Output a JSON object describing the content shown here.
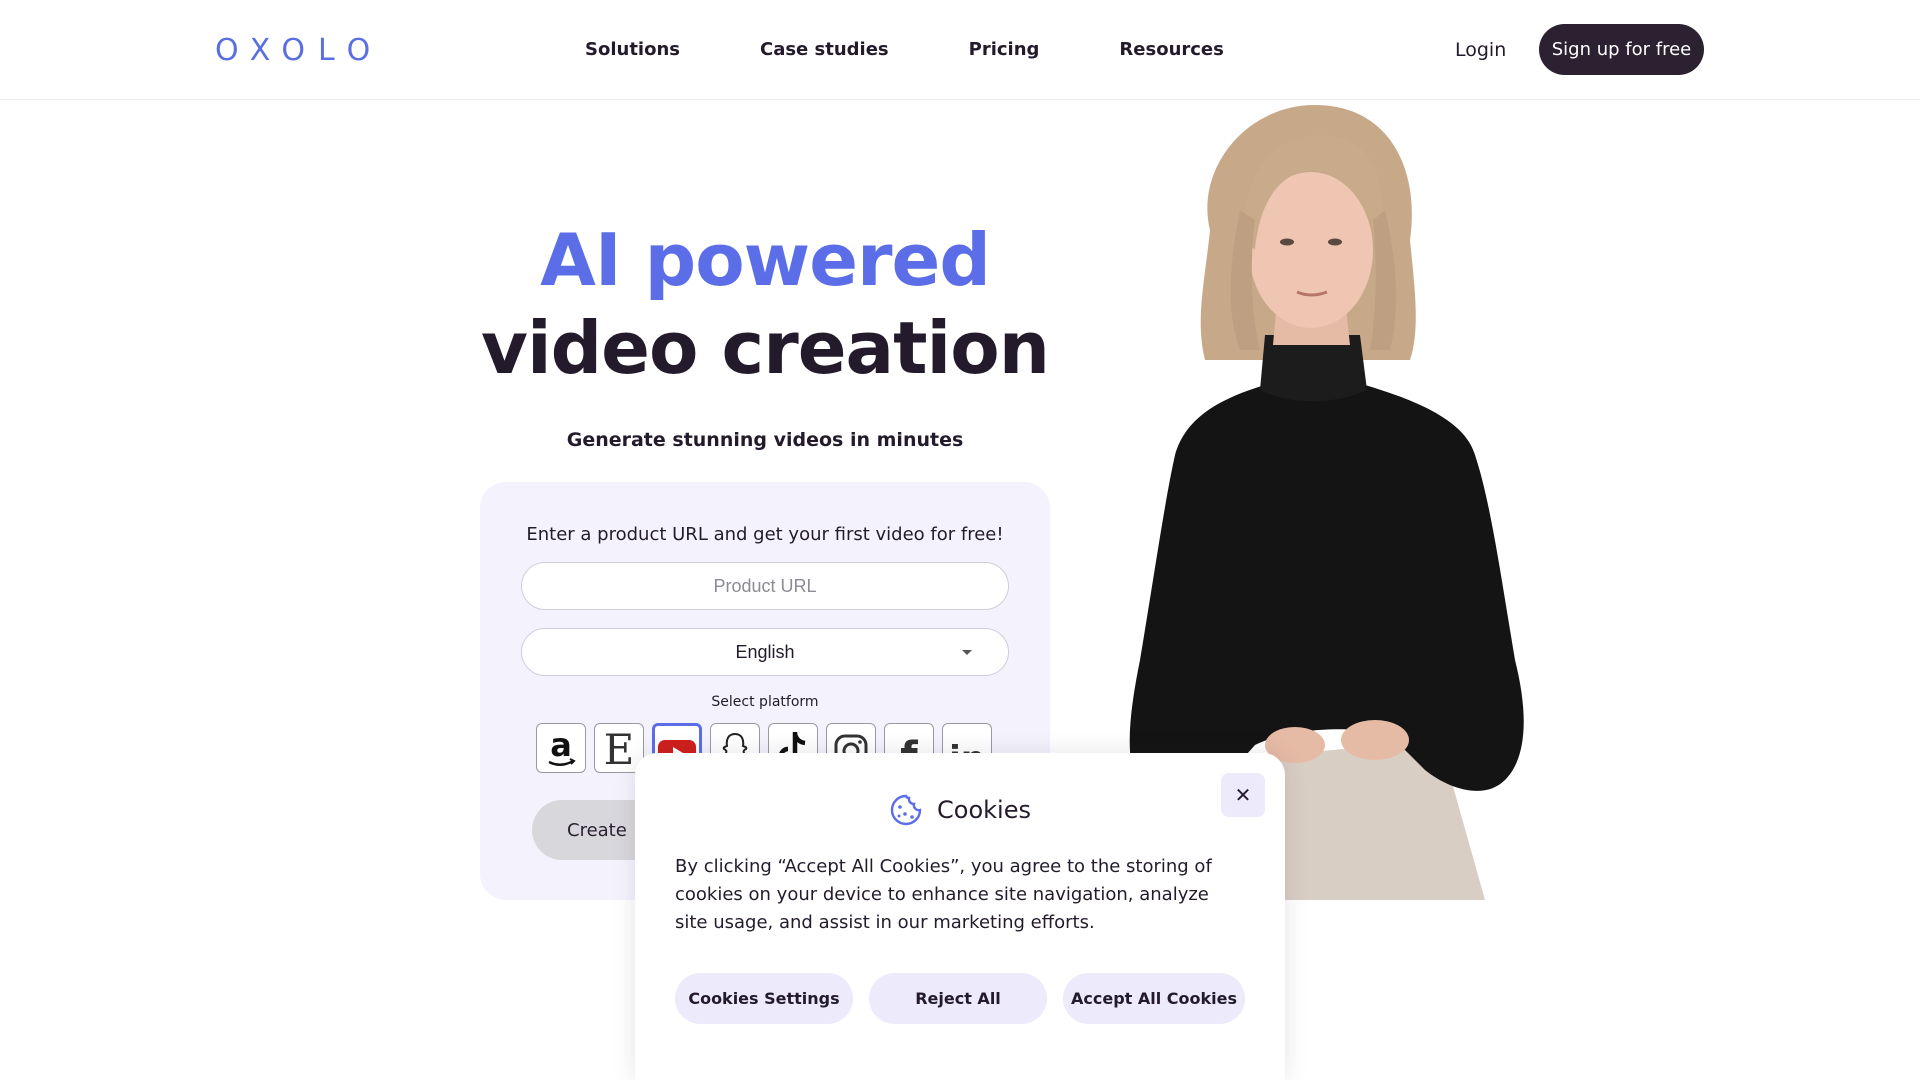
{
  "header": {
    "logo": "OXOLO",
    "nav": [
      "Solutions",
      "Case studies",
      "Pricing",
      "Resources"
    ],
    "login": "Login",
    "signup": "Sign up for free"
  },
  "hero": {
    "title_line1": "AI powered",
    "title_line2": "video creation",
    "subtitle": "Generate stunning videos in minutes"
  },
  "form": {
    "prompt": "Enter a product URL and get your first video for free!",
    "url_placeholder": "Product URL",
    "language": "English",
    "platform_label": "Select platform",
    "platforms": [
      {
        "name": "amazon",
        "icon": "amazon-icon"
      },
      {
        "name": "etsy",
        "icon": "etsy-icon"
      },
      {
        "name": "youtube",
        "icon": "youtube-icon",
        "selected": true
      },
      {
        "name": "snapchat",
        "icon": "snapchat-icon"
      },
      {
        "name": "tiktok",
        "icon": "tiktok-icon"
      },
      {
        "name": "instagram",
        "icon": "instagram-icon"
      },
      {
        "name": "facebook",
        "icon": "facebook-icon"
      },
      {
        "name": "linkedin",
        "icon": "linkedin-icon"
      }
    ],
    "create_label": "Create"
  },
  "cookies": {
    "title": "Cookies",
    "text": "By clicking “Accept All Cookies”, you agree to the storing of cookies on your device to enhance site navigation, analyze site usage, and assist in our marketing efforts.",
    "settings": "Cookies Settings",
    "reject": "Reject All",
    "accept": "Accept All Cookies",
    "close": "✕"
  },
  "colors": {
    "accent": "#5b6ee8",
    "dark": "#2b2131",
    "card_bg": "#f4f3fd",
    "button_light": "#eceafb"
  }
}
